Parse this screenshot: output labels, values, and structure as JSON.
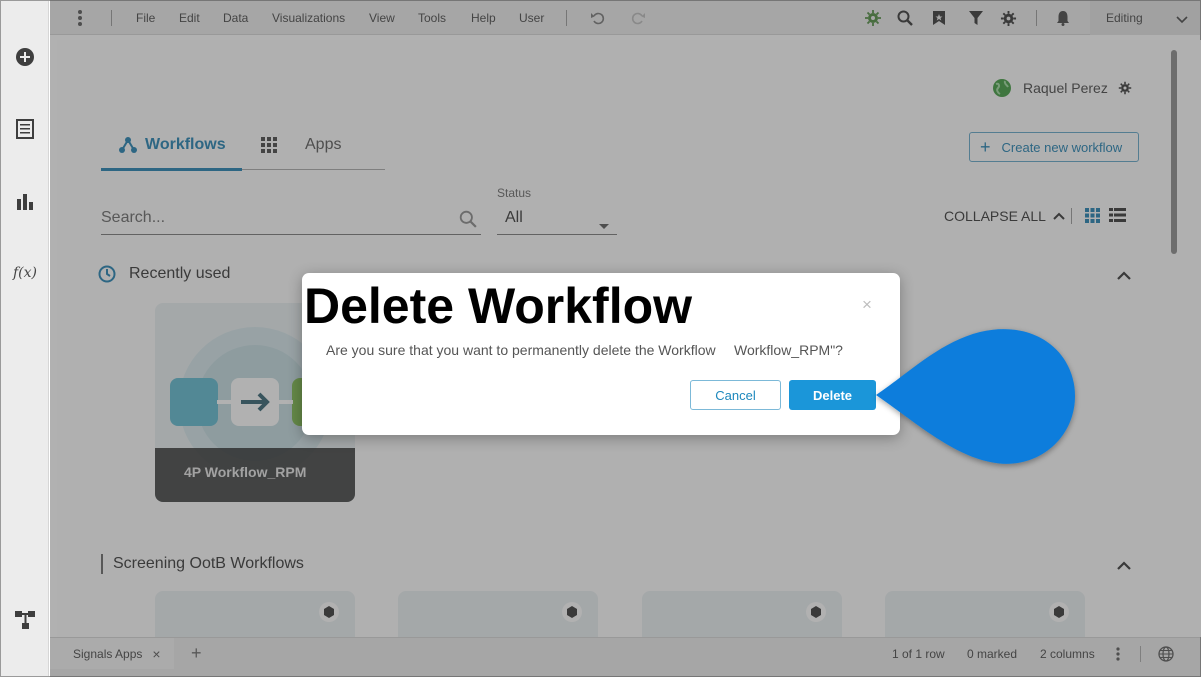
{
  "menubar": {
    "items": [
      "File",
      "Edit",
      "Data",
      "Visualizations",
      "View",
      "Tools",
      "Help",
      "User"
    ],
    "mode": "Editing"
  },
  "user": {
    "name": "Raquel Perez"
  },
  "tabs": [
    {
      "label": "Workflows",
      "active": true
    },
    {
      "label": "Apps",
      "active": false
    }
  ],
  "create_button": "Create new workflow",
  "search": {
    "placeholder": "Search..."
  },
  "status": {
    "label": "Status",
    "value": "All"
  },
  "collapse_all": "COLLAPSE ALL",
  "sections": {
    "recent": "Recently used",
    "screening": "Screening OotB Workflows"
  },
  "cards": [
    {
      "title": "4P Workflow_RPM"
    }
  ],
  "bottombar": {
    "tab_label": "Signals Apps",
    "rows": "1 of 1 row",
    "marked": "0 marked",
    "columns": "2 columns"
  },
  "dialog": {
    "title": "Delete Workflow",
    "message": "Are you sure that you want to permanently delete the Workflow",
    "message_name": "Workflow_RPM\"?",
    "close": "×",
    "cancel": "Cancel",
    "delete": "Delete"
  },
  "colors": {
    "accent": "#1b96d9",
    "tab_active": "#1d7fb0",
    "callout": "#0b7ddc"
  },
  "icons": [
    "add-icon",
    "document-icon",
    "bar-chart-icon",
    "function-icon",
    "hierarchy-icon",
    "more-vertical-icon",
    "undo-icon",
    "redo-icon",
    "gear-icon",
    "search-icon",
    "bookmark-icon",
    "filter-icon",
    "settings-icon",
    "bell-icon",
    "chevron-down-icon",
    "globe-icon",
    "workflow-icon",
    "grid-icon",
    "list-icon",
    "clock-icon",
    "chevron-up-icon",
    "plus-icon",
    "close-icon",
    "cube-icon",
    "arrow-right-icon"
  ]
}
